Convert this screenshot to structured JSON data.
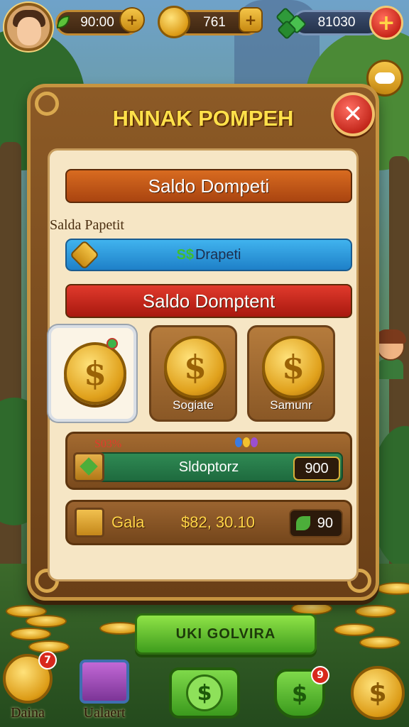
{
  "top_bar": {
    "energy_value": "90:00",
    "coins_value": "761",
    "gems_value": "81030",
    "plus_symbol": "+"
  },
  "dialog": {
    "title": "HNNAK POMPEH",
    "close_symbol": "✕",
    "balance_header": "Saldo Dompeti",
    "balance_sublabel": "Salda Papetit",
    "blue_bar": {
      "prefix": "S$",
      "text": "Drapeti"
    },
    "red_header": "Saldo Domptent",
    "coin_options": [
      {
        "label": "",
        "selected": true
      },
      {
        "label": "Sogiate",
        "selected": false
      },
      {
        "label": "Samunr",
        "selected": false
      }
    ],
    "reward_row": {
      "percent": "S03%",
      "name": "Sldoptorz",
      "value": "900"
    },
    "gold_row": {
      "label": "Gala",
      "amount": "$82, 30.10",
      "chip_value": "90"
    },
    "confirm_label": "UKI GOLVIRA"
  },
  "bottom_nav": [
    {
      "label": "Daina",
      "badge": "7",
      "icon": "coin-icon"
    },
    {
      "label": "Ualaert",
      "badge": "",
      "icon": "chest-icon"
    },
    {
      "label": "",
      "badge": "",
      "icon": "dollar-coin-icon"
    },
    {
      "label": "",
      "badge": "9",
      "icon": "dollar-shield-icon"
    },
    {
      "label": "",
      "badge": "",
      "icon": "gold-coin-icon"
    }
  ],
  "colors": {
    "gold": "#ffd447",
    "brown_frame": "#8c5a26",
    "panel": "#f6e6c5",
    "green_button": "#6cc93a",
    "red_close": "#c02418"
  }
}
